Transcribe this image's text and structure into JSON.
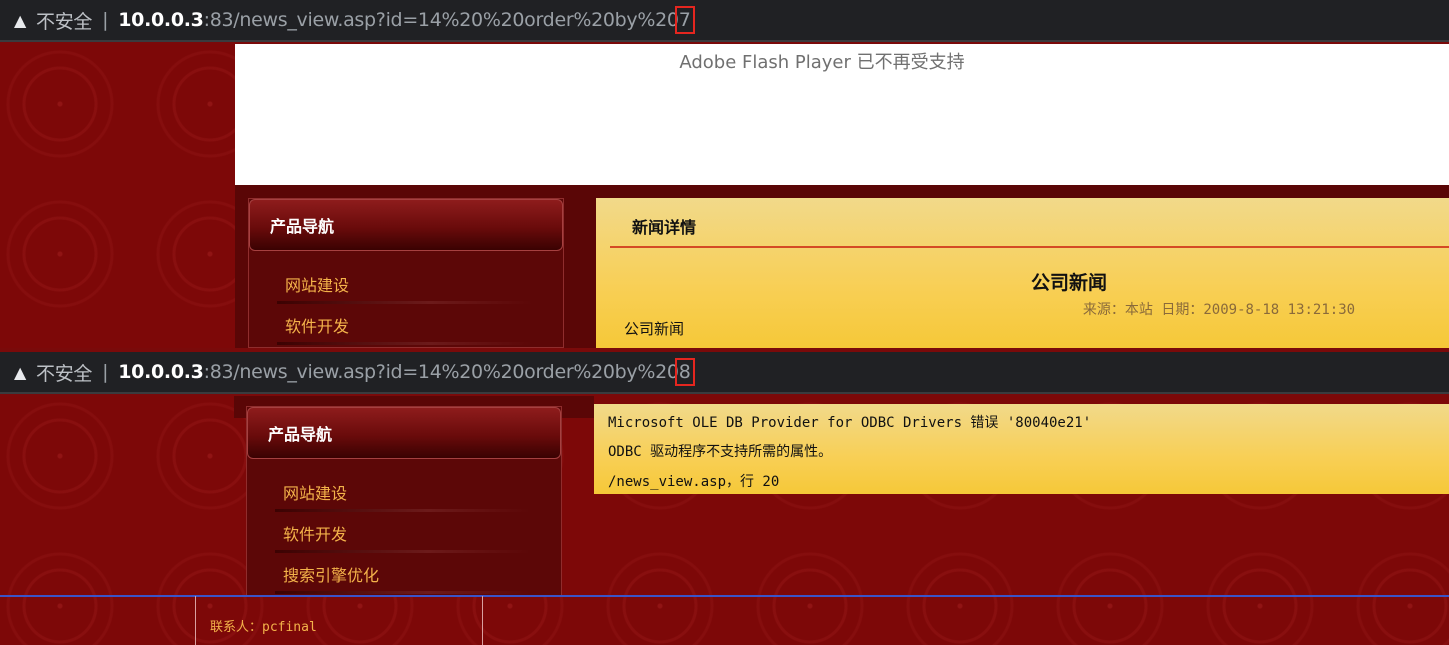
{
  "top": {
    "addr": {
      "warning_icon": "warning-triangle-icon",
      "insecure_label": "不安全",
      "separator": "|",
      "host": "10.0.0.3",
      "port_path": ":83/news_view.asp?id=14%20%20order%20by%20",
      "highlighted": "7"
    },
    "flash_notice": "Adobe Flash Player 已不再受支持",
    "nav": {
      "title": "产品导航",
      "items": [
        "网站建设",
        "软件开发"
      ]
    },
    "news": {
      "header": "新闻详情",
      "title": "公司新闻",
      "meta": "来源：本站  日期：2009-8-18 13:21:30",
      "body": "公司新闻"
    }
  },
  "bottom": {
    "addr": {
      "warning_icon": "warning-triangle-icon",
      "insecure_label": "不安全",
      "separator": "|",
      "host": "10.0.0.3",
      "port_path": ":83/news_view.asp?id=14%20%20order%20by%20",
      "highlighted": "8"
    },
    "nav": {
      "title": "产品导航",
      "items": [
        "网站建设",
        "软件开发",
        "搜索引擎优化"
      ]
    },
    "error": {
      "line1": "Microsoft OLE DB Provider for ODBC Drivers 错误 '80040e21'",
      "line2": "ODBC 驱动程序不支持所需的属性。",
      "line3": "/news_view.asp，行 20"
    },
    "footer": {
      "contact": "联系人：pcfinal"
    }
  }
}
